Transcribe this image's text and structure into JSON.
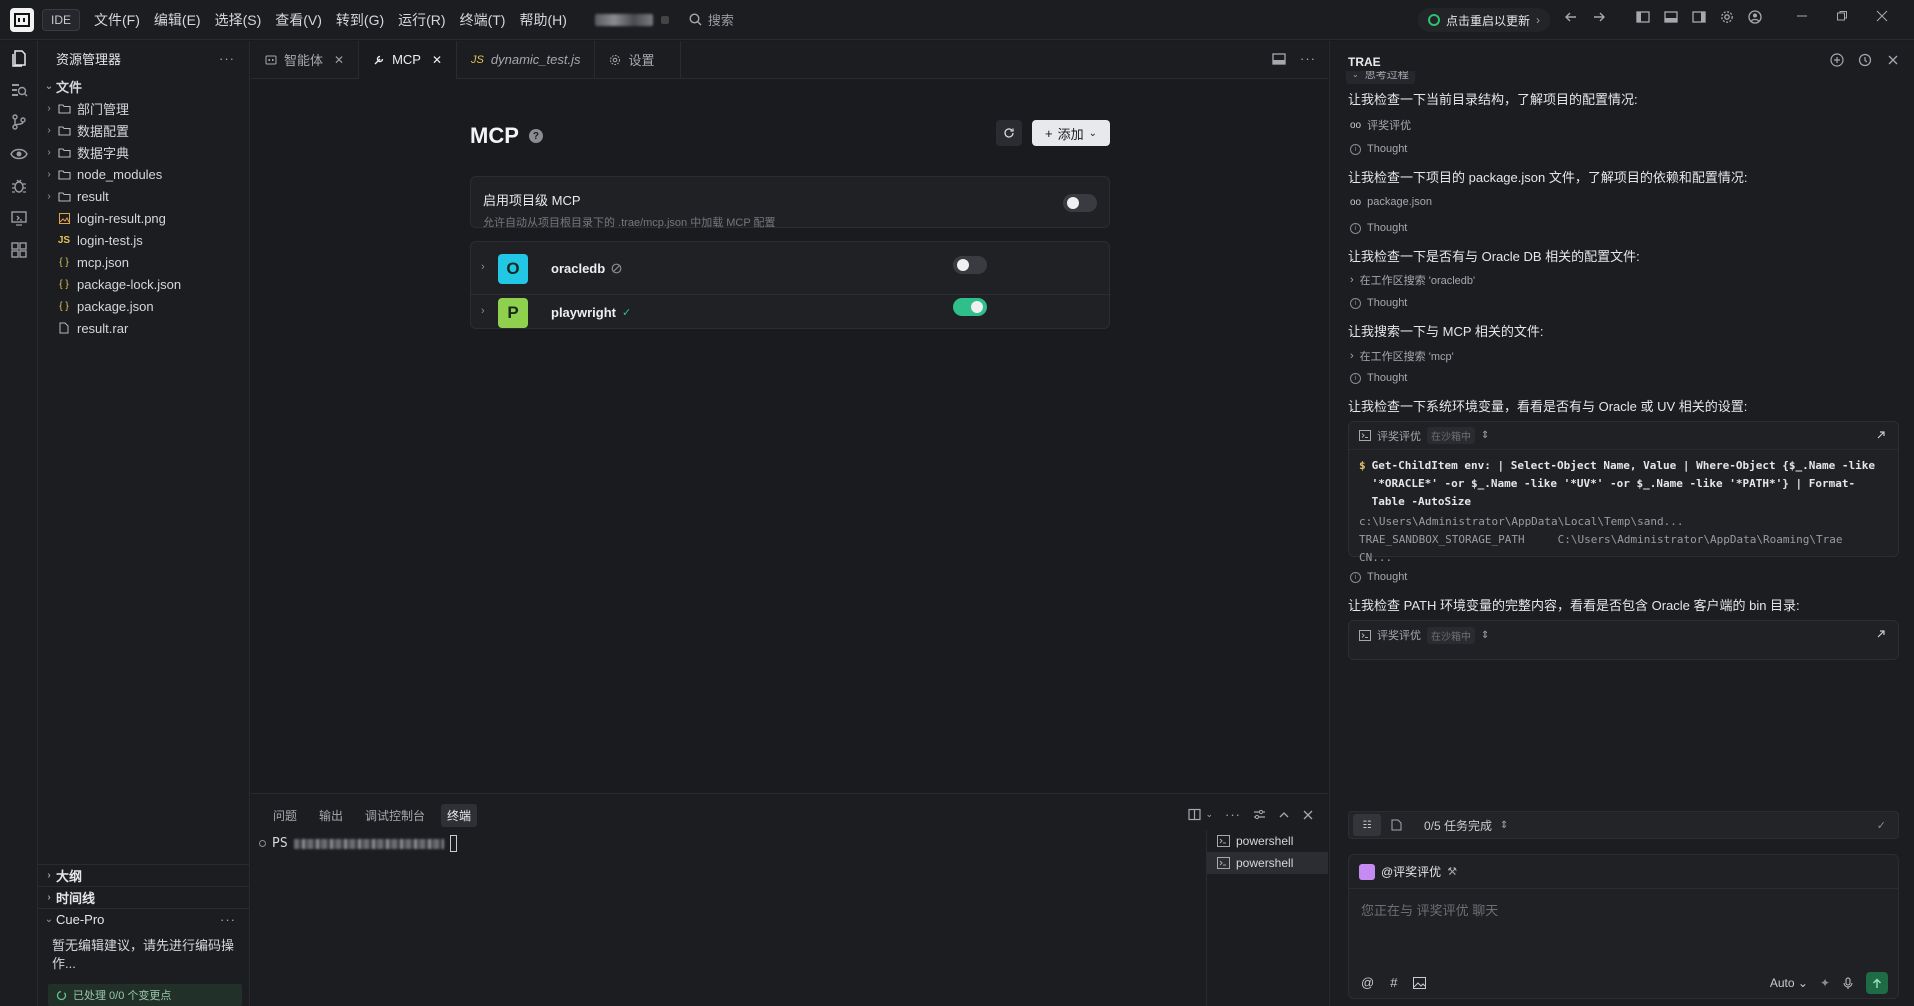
{
  "titlebar": {
    "ide_badge": "IDE",
    "menus": [
      "文件(F)",
      "编辑(E)",
      "选择(S)",
      "查看(V)",
      "转到(G)",
      "运行(R)",
      "终端(T)",
      "帮助(H)"
    ],
    "search_label": "搜索",
    "update_label": "点击重启以更新"
  },
  "sidebar": {
    "title": "资源管理器",
    "root_label": "文件",
    "items": [
      {
        "label": "部门管理",
        "type": "folder"
      },
      {
        "label": "数据配置",
        "type": "folder"
      },
      {
        "label": "数据字典",
        "type": "folder"
      },
      {
        "label": "node_modules",
        "type": "folder"
      },
      {
        "label": "result",
        "type": "folder"
      },
      {
        "label": "login-result.png",
        "type": "image"
      },
      {
        "label": "login-test.js",
        "type": "js"
      },
      {
        "label": "mcp.json",
        "type": "json"
      },
      {
        "label": "package-lock.json",
        "type": "json"
      },
      {
        "label": "package.json",
        "type": "json"
      },
      {
        "label": "result.rar",
        "type": "file"
      }
    ],
    "outline_label": "大纲",
    "timeline_label": "时间线",
    "cue_label": "Cue-Pro",
    "cue_text": "暂无编辑建议，请先进行编码操作...",
    "processed_label": "已处理 0/0 个变更点"
  },
  "editor": {
    "tabs": [
      {
        "label": "智能体",
        "icon": "agent-icon",
        "closable": true,
        "active": false
      },
      {
        "label": "MCP",
        "icon": "tool-icon",
        "closable": true,
        "active": true
      },
      {
        "label": "dynamic_test.js",
        "icon": "js-icon",
        "closable": false,
        "active": false
      },
      {
        "label": "设置",
        "icon": "gear-icon",
        "closable": false,
        "active": false
      }
    ],
    "js_tag": "JS",
    "page_title": "MCP",
    "add_label": "添加",
    "project_mcp": {
      "title": "启用项目级 MCP",
      "subtitle": "允许自动从项目根目录下的 .trae/mcp.json 中加载 MCP 配置",
      "enabled": false
    },
    "servers": [
      {
        "initial": "O",
        "name": "oracledb",
        "color": "#22c7e6",
        "enabled": false,
        "status_icon": "disabled-icon"
      },
      {
        "initial": "P",
        "name": "playwright",
        "color": "#8fd14f",
        "enabled": true,
        "status_icon": "check-icon"
      }
    ]
  },
  "panel": {
    "tabs": [
      "问题",
      "输出",
      "调试控制台",
      "终端"
    ],
    "active_tab": "终端",
    "prompt": "PS",
    "terminals": [
      "powershell",
      "powershell"
    ]
  },
  "chat": {
    "title": "TRAE",
    "collapsed_label": "思考过程",
    "messages": [
      {
        "text": "让我检查一下当前目录结构，了解项目的配置情况:"
      },
      {
        "text": "让我检查一下项目的 package.json 文件，了解项目的依赖和配置情况:"
      },
      {
        "text": "让我检查一下是否有与 Oracle DB 相关的配置文件:"
      },
      {
        "text": "让我搜索一下与 MCP 相关的文件:"
      },
      {
        "text": "让我检查一下系统环境变量，看看是否有与 Oracle 或 UV 相关的设置:"
      },
      {
        "text": "让我检查 PATH 环境变量的完整内容，看看是否包含 Oracle 客户端的 bin 目录:"
      }
    ],
    "tool_rows": [
      {
        "icon": "glasses-icon",
        "text": "评奖评优"
      },
      {
        "icon": "glasses-icon",
        "text": "package.json"
      },
      {
        "icon": "chevron-right-icon",
        "text": "在工作区搜索 'oracledb'"
      },
      {
        "icon": "chevron-right-icon",
        "text": "在工作区搜索 'mcp'"
      }
    ],
    "thought_label": "Thought",
    "code_cards": [
      {
        "name": "评奖评优",
        "tag": "在沙箱中",
        "command": "Get-ChildItem env: | Select-Object Name, Value | Where-Object {$_.Name -like '*ORACLE*' -or $_.Name -like '*UV*' -or $_.Name -like '*PATH*'} | Format-Table -AutoSize",
        "output": "c:\\Users\\Administrator\\AppData\\Local\\Temp\\sand...\nTRAE_SANDBOX_STORAGE_PATH     C:\\Users\\Administrator\\AppData\\Roaming\\Trae\nCN..."
      },
      {
        "name": "评奖评优",
        "tag": "在沙箱中"
      }
    ],
    "task_label": "0/5 任务完成",
    "agent_label": "@评奖评优",
    "input_placeholder": "您正在与 评奖评优 聊天",
    "mode_label": "Auto"
  }
}
